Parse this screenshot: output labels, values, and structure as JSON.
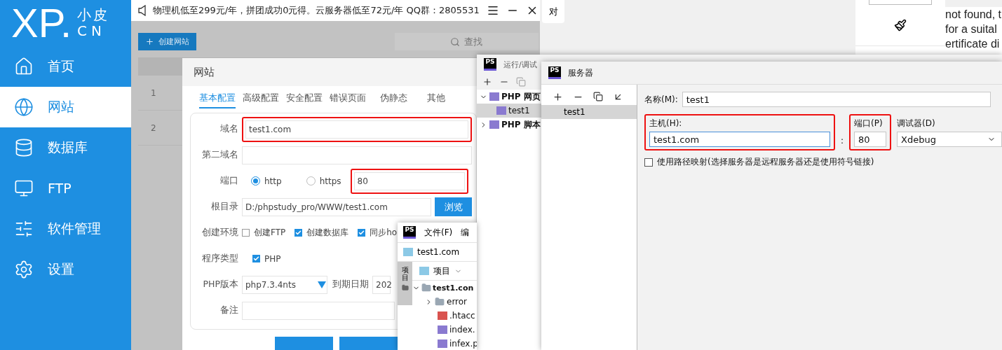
{
  "sidebar": {
    "logo": {
      "mark": "XP.",
      "cn_name": "小皮",
      "domain": "CN"
    },
    "nav": [
      {
        "label": "首页",
        "selected": false
      },
      {
        "label": "网站",
        "selected": true
      },
      {
        "label": "数据库",
        "selected": false
      },
      {
        "label": "FTP",
        "selected": false
      },
      {
        "label": "软件管理",
        "selected": false
      },
      {
        "label": "设置",
        "selected": false
      }
    ]
  },
  "top_bar": {
    "notice": "物理机低至299元/年，拼团成功0元得。云服务器低至72元/年  QQ群：2805531"
  },
  "toolbar": {
    "create_button": "创建网站",
    "search_placeholder": "查找"
  },
  "table": {
    "rows": [
      "1",
      "2"
    ]
  },
  "site_dialog": {
    "title": "网站",
    "tabs": [
      {
        "label": "基本配置",
        "selected": true
      },
      {
        "label": "高级配置",
        "selected": false
      },
      {
        "label": "安全配置",
        "selected": false
      },
      {
        "label": "错误页面",
        "selected": false
      },
      {
        "label": "伪静态",
        "selected": false
      },
      {
        "label": "其他",
        "selected": false
      }
    ],
    "domain": {
      "label": "域名",
      "value": "test1.com"
    },
    "second_domain": {
      "label": "第二域名"
    },
    "port": {
      "label": "端口",
      "options": [
        {
          "label": "http",
          "selected": true
        },
        {
          "label": "https",
          "selected": false
        }
      ],
      "value": "80"
    },
    "root": {
      "label": "根目录",
      "value": "D:/phpstudy_pro/WWW/test1.com",
      "button": "浏览"
    },
    "environment": {
      "label": "创建环境",
      "options": [
        {
          "label": "创建FTP",
          "checked": false
        },
        {
          "label": "创建数据库",
          "checked": true
        },
        {
          "label": "同步ho",
          "checked": true
        }
      ]
    },
    "program_type": {
      "label": "程序类型",
      "options": [
        {
          "label": "PHP",
          "checked": true
        }
      ]
    },
    "php_version": {
      "label": "PHP版本",
      "value": "php7.3.4nts",
      "date_label": "到期日期",
      "date_value": "202"
    },
    "note": {
      "label": "备注"
    }
  },
  "background": {
    "tab_text": "对",
    "browser_lines": [
      "not found, t",
      "for a suital",
      "ertificate di"
    ]
  },
  "run_config": {
    "badge": "PS",
    "title": "运行/调试",
    "tree": [
      {
        "label": "PHP 网页",
        "selected": false,
        "expanded": true,
        "children": [
          {
            "label": "test1",
            "selected": true
          }
        ]
      },
      {
        "label": "PHP 脚本",
        "selected": false,
        "expanded": false
      }
    ]
  },
  "server": {
    "badge": "PS",
    "title": "服务器",
    "list": [
      {
        "label": "test1",
        "selected": true
      }
    ],
    "name_label": "名称(M):",
    "name_value": "test1",
    "host_label": "主机(H):",
    "host_value": "test1.com",
    "separator": ":",
    "port_label": "端口(P)",
    "port_value": "80",
    "debugger_label": "调试器(D)",
    "debugger_value": "Xdebug",
    "path_mapping": {
      "label": "使用路径映射(选择服务器是远程服务器还是使用符号链接)",
      "checked": false
    }
  },
  "storm": {
    "badge": "PS",
    "menu": [
      "文件(F)",
      "编"
    ],
    "project": "test1.com",
    "side_tab": "项目",
    "view": "项目",
    "tree": [
      {
        "label": "test1.con",
        "expanded": true,
        "children": [
          {
            "label": "error",
            "kind": "folder",
            "expanded": false
          },
          {
            "label": ".htacc",
            "kind": "config"
          },
          {
            "label": "index.",
            "kind": "php"
          },
          {
            "label": "infex.p",
            "kind": "php"
          }
        ]
      }
    ]
  }
}
